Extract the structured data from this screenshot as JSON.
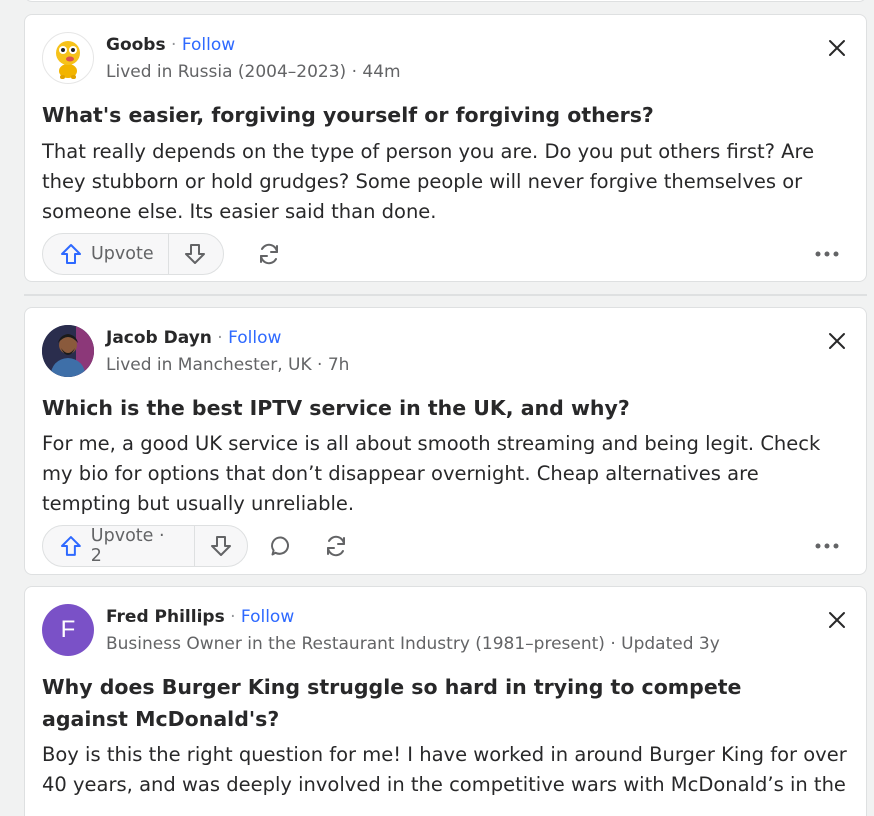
{
  "posts": [
    {
      "author": "Goobs",
      "follow": "Follow",
      "dot": "·",
      "credential": "Lived in Russia (2004–2023) · 44m",
      "question": "What's easier, forgiving yourself or forgiving others?",
      "answer": "That really depends on the type of person you are. Do you put others first? Are they stubborn or hold grudges? Some people will never forgive themselves or someone else. Its easier said than done.",
      "upvote": "Upvote"
    },
    {
      "author": "Jacob Dayn",
      "follow": "Follow",
      "dot": "·",
      "credential": "Lived in Manchester, UK · 7h",
      "question": "Which is the best IPTV service in the UK, and why?",
      "answer": "For me, a good UK service is all about smooth streaming and being legit. Check my bio for options that don’t disappear overnight. Cheap alternatives are tempting but usually unreliable.",
      "upvote": "Upvote · 2"
    },
    {
      "author": "Fred Phillips",
      "follow": "Follow",
      "dot": "·",
      "avatar_letter": "F",
      "credential": "Business Owner in the Restaurant Industry (1981–present) · Updated 3y",
      "question": "Why does Burger King struggle so hard in trying to compete against McDonald's?",
      "answer": "Boy is this the right question for me! I have worked in around Burger King for over 40 years, and was deeply involved in the competitive wars with McDonald’s in the"
    }
  ],
  "colors": {
    "accent": "#2e69ff",
    "avatar_purple": "#7a51c7",
    "text": "#282829",
    "muted": "#636466"
  },
  "icons": [
    "close-icon",
    "upvote-arrow-icon",
    "downvote-arrow-icon",
    "share-icon",
    "comment-icon",
    "more-icon"
  ]
}
